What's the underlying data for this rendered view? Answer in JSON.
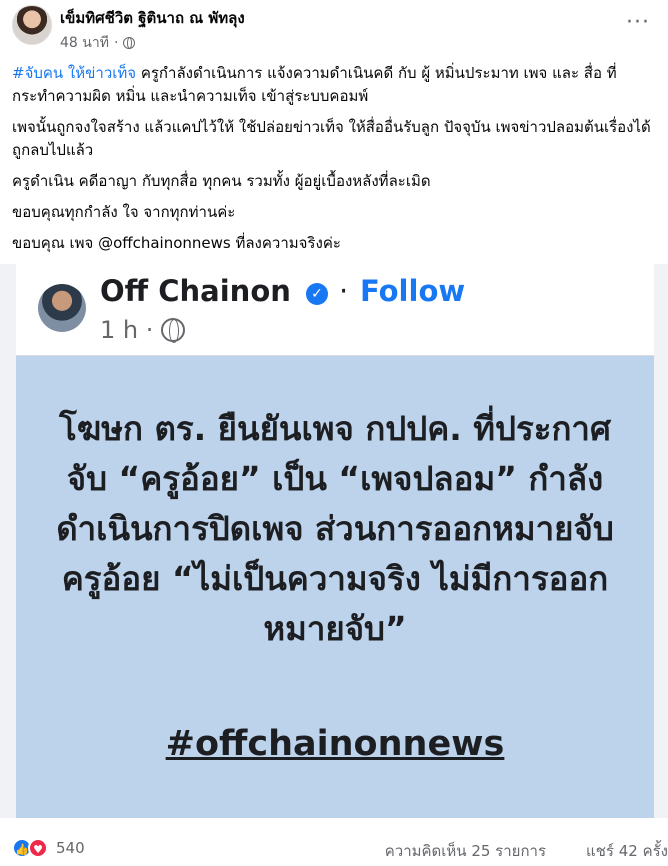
{
  "post": {
    "author": "เข็มทิศชีวิต ฐิตินาถ ณ พัทลุง",
    "time": "48 นาที",
    "dot": "·",
    "more": "···",
    "hashtags": "#จับคน ให้ข่าวเท็จ",
    "p1": "ครูกำลังดำเนินการ แจ้งความดำเนินคดี กับ ผู้ หมิ่นประมาท เพจ และ สื่อ ที่กระทำความผิด หมิ่น และนำความเท็จ เข้าสู่ระบบคอมพ์",
    "p2": "เพจนั้นถูกจงใจสร้าง แล้วแคปไว้ให้ ใช้ปล่อยข่าวเท็จ ให้สื่ออื่นรับลูก ปัจจุบัน เพจข่าวปลอมต้นเรื่องได้ถูกลบไปแล้ว",
    "p3": "ครูดำเนิน คดีอาญา กับทุกสื่อ ทุกคน รวมทั้ง ผู้อยู่เบื้องหลังที่ละเมิด",
    "p4": "ขอบคุณทุกกำลัง ใจ จากทุกท่านค่ะ",
    "p5": "ขอบคุณ เพจ @offchainonnews ที่ลงความจริงค่ะ"
  },
  "embedded": {
    "name": "Off Chainon",
    "verified": "✓",
    "dot": "·",
    "follow": "Follow",
    "time": "1 h ·",
    "body": "โฆษก ตร. ยืนยันเพจ กปปค. ที่ประกาศจับ “ครูอ้อย” เป็น “เพจปลอม” กำลังดำเนินการปิดเพจ ส่วนการออกหมายจับครูอ้อย “ไม่เป็นความจริง ไม่มีการออกหมายจับ”",
    "hashtag": "#offchainonnews"
  },
  "footer": {
    "reactions": "540",
    "like_icon": "👍",
    "love_icon": "♥",
    "comments": "ความคิดเห็น 25 รายการ",
    "shares": "แชร์ 42 ครั้ง"
  },
  "colors": {
    "link": "#1877f2",
    "image_bg": "#bdd3ec",
    "love": "#f02849"
  }
}
